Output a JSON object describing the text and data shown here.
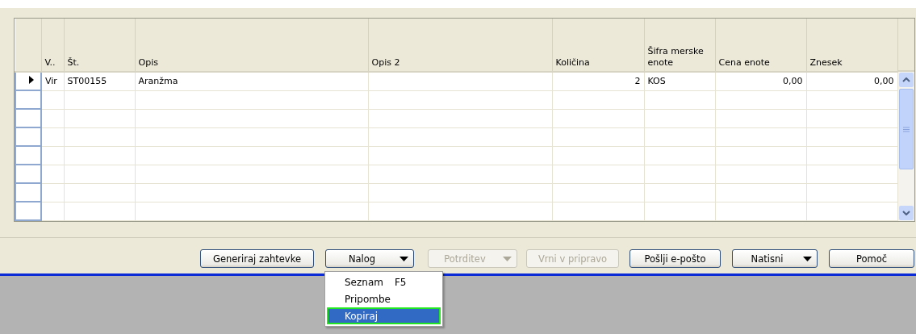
{
  "table": {
    "columns": [
      {
        "label": "V.."
      },
      {
        "label": "Št."
      },
      {
        "label": "Opis"
      },
      {
        "label": "Opis 2"
      },
      {
        "label": "Količina"
      },
      {
        "label": "Šifra merske enote"
      },
      {
        "label": "Cena enote"
      },
      {
        "label": "Znesek"
      }
    ],
    "rows": [
      {
        "current": true,
        "cells": [
          "Vir",
          "ST00155",
          "Aranžma",
          "",
          "2",
          "KOS",
          "0,00",
          "0,00"
        ]
      },
      {
        "current": false
      },
      {
        "current": false
      },
      {
        "current": false
      },
      {
        "current": false
      },
      {
        "current": false
      },
      {
        "current": false
      },
      {
        "current": false
      }
    ]
  },
  "buttons": [
    {
      "label": "Generiraj zahtevke",
      "kind": "plain",
      "disabled": false
    },
    {
      "label": "Nalog",
      "kind": "dropdown",
      "disabled": false
    },
    {
      "label": "Potrditev",
      "kind": "dropdown",
      "disabled": true
    },
    {
      "label": "Vrni v pripravo",
      "kind": "plain",
      "disabled": true
    },
    {
      "label": "Pošlji e-pošto",
      "kind": "plain",
      "disabled": false
    },
    {
      "label": "Natisni",
      "kind": "dropdown",
      "disabled": false
    },
    {
      "label": "Pomoč",
      "kind": "plain",
      "disabled": false
    }
  ],
  "menu": {
    "items": [
      {
        "label": "Seznam",
        "shortcut": "F5",
        "selected": false
      },
      {
        "label": "Pripombe",
        "selected": false
      },
      {
        "label": "Kopiraj",
        "selected": true
      }
    ]
  }
}
